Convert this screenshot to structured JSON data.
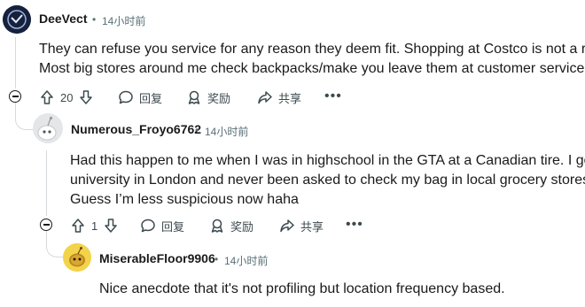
{
  "comments": [
    {
      "author": "DeeVect",
      "separator": "•",
      "time": "14小时前",
      "lines": [
        "They can refuse you service for any reason they deem fit. Shopping at Costco is not a right.",
        "Most big stores around me check backpacks/make you leave them at customer service."
      ],
      "votes": "20",
      "reply_label": "回复",
      "award_label": "奖励",
      "share_label": "共享",
      "more_label": "•••"
    },
    {
      "author": "Numerous_Froyo6762",
      "separator": "•",
      "time": "14小时前",
      "lines": [
        "Had this happen to me when I was in highschool in the GTA at a Canadian tire. I go to",
        "university in London and never been asked to check my bag in local grocery stores.",
        "Guess I’m less suspicious now haha"
      ],
      "votes": "1",
      "reply_label": "回复",
      "award_label": "奖励",
      "share_label": "共享",
      "more_label": "•••"
    },
    {
      "author": "MiserableFloor9906",
      "separator": "•",
      "time": "14小时前",
      "lines": [
        "Nice anecdote that it's not profiling but location frequency based."
      ]
    }
  ],
  "icons": {
    "upvote": "arrow-up-icon",
    "downvote": "arrow-down-icon",
    "reply": "speech-bubble-icon",
    "award": "award-ribbon-icon",
    "share": "share-arrow-icon",
    "collapse": "collapse-minus-icon"
  },
  "colors": {
    "text": "#1a1a1b",
    "meta": "#576f76",
    "thread_line": "#d6dadc",
    "avatar_dark": "#1b2a49",
    "avatar_snoo_yellow": "#e8c21a"
  }
}
